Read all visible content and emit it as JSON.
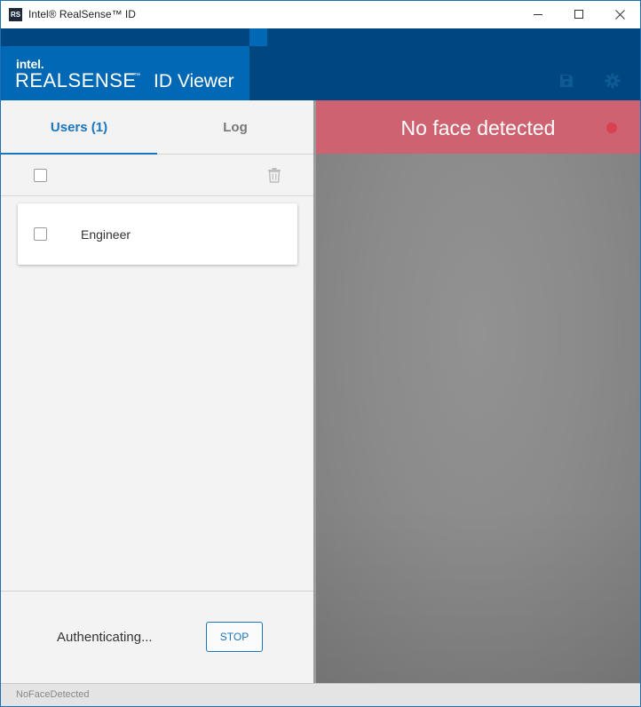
{
  "window": {
    "title": "Intel® RealSense™ ID",
    "icon_text": "RS"
  },
  "header": {
    "brand_intel": "intel.",
    "brand_realsense": "REALSENSE",
    "brand_tm": "™",
    "app_name": "ID Viewer",
    "icons": [
      "save-icon",
      "gear-icon"
    ]
  },
  "tabs": [
    {
      "label": "Users (1)",
      "active": true
    },
    {
      "label": "Log",
      "active": false
    }
  ],
  "users": [
    {
      "name": "Engineer",
      "checked": false
    }
  ],
  "footer": {
    "status": "Authenticating...",
    "stop_label": "STOP"
  },
  "camera": {
    "banner": "No face detected"
  },
  "statusbar": {
    "text": "NoFaceDetected"
  },
  "colors": {
    "header": "#00467f",
    "brand": "#0068b5",
    "accent": "#1a75bf",
    "banner": "#cf6270"
  }
}
